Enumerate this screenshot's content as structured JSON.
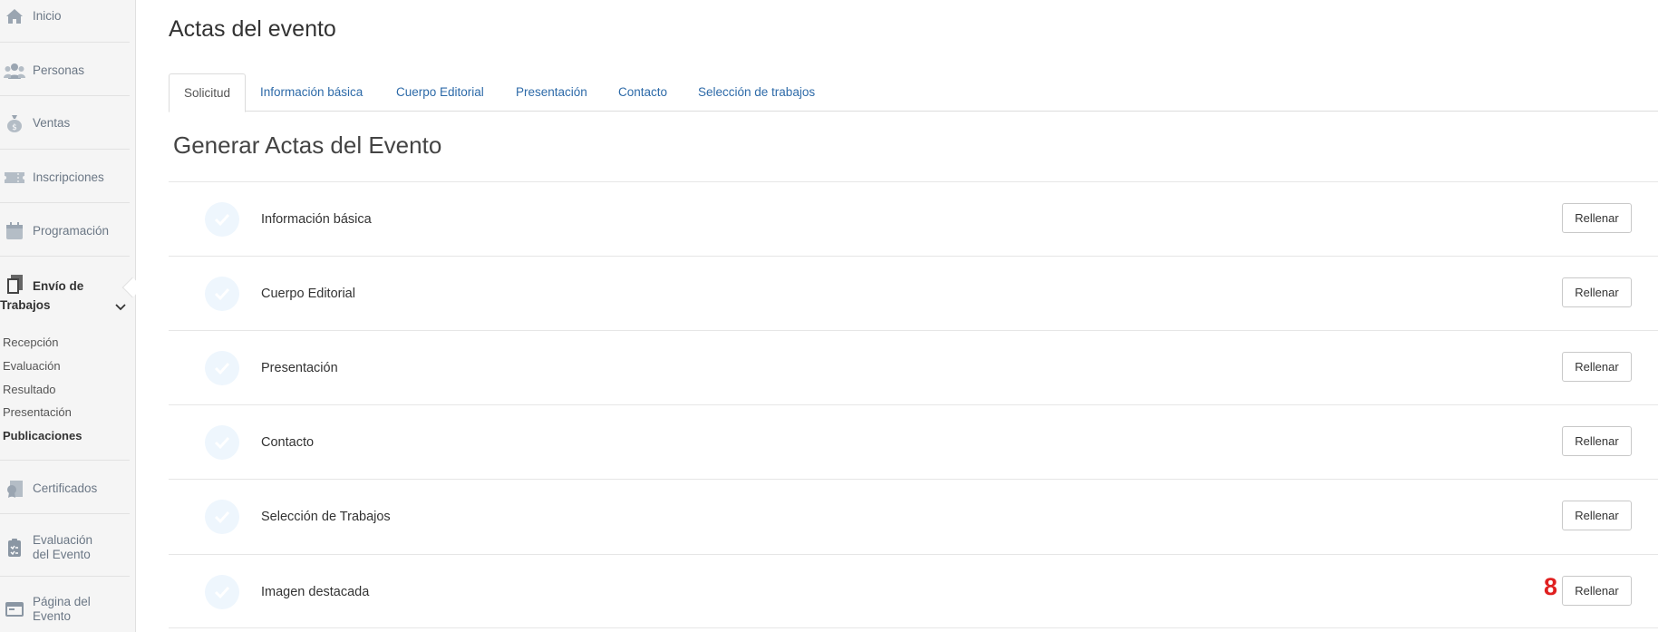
{
  "sidebar": {
    "items": [
      {
        "label": "Inicio",
        "icon": "home-icon"
      },
      {
        "label": "Personas",
        "icon": "people-icon"
      },
      {
        "label": "Ventas",
        "icon": "money-bag-icon"
      },
      {
        "label": "Inscripciones",
        "icon": "ticket-icon"
      },
      {
        "label": "Programación",
        "icon": "calendar-icon"
      },
      {
        "label": "Envío de Trabajos",
        "icon": "documents-icon"
      },
      {
        "label": "Certificados",
        "icon": "certificate-icon"
      },
      {
        "label": "Evaluación del Evento",
        "icon": "clipboard-icon"
      },
      {
        "label": "Página del Evento",
        "icon": "webpage-icon"
      }
    ],
    "submenu": [
      "Recepción",
      "Evaluación",
      "Resultado",
      "Presentación",
      "Publicaciones"
    ]
  },
  "page": {
    "title": "Actas del evento",
    "section_title": "Generar Actas del Evento"
  },
  "tabs": [
    "Solicitud",
    "Información básica",
    "Cuerpo Editorial",
    "Presentación",
    "Contacto",
    "Selección de trabajos"
  ],
  "rows": [
    {
      "label": "Información básica",
      "button": "Rellenar"
    },
    {
      "label": "Cuerpo Editorial",
      "button": "Rellenar"
    },
    {
      "label": "Presentación",
      "button": "Rellenar"
    },
    {
      "label": "Contacto",
      "button": "Rellenar"
    },
    {
      "label": "Selección de Trabajos",
      "button": "Rellenar"
    },
    {
      "label": "Imagen destacada",
      "button": "Rellenar",
      "badge": "8"
    }
  ],
  "colors": {
    "tab_link": "#2d6aa8",
    "badge": "#e02020",
    "check": "#eef6fd"
  }
}
